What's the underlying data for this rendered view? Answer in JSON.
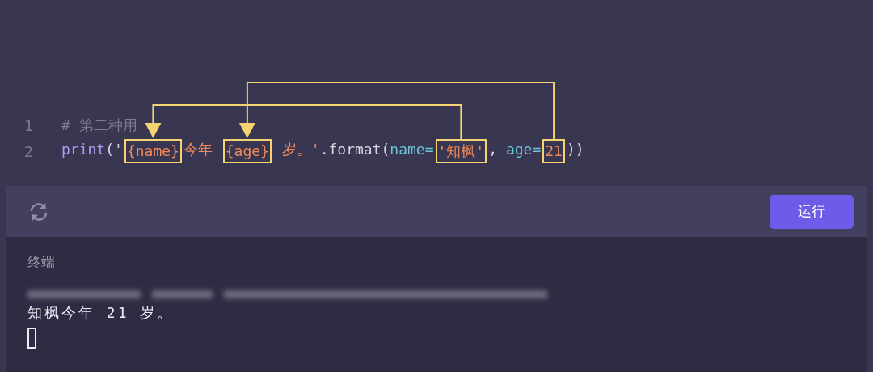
{
  "editor": {
    "lines": [
      {
        "number": "1",
        "tokens": [
          {
            "text": "# 第二种用",
            "kind": "comment",
            "boxed": false
          }
        ]
      },
      {
        "number": "2",
        "tokens": [
          {
            "text": "print",
            "kind": "function",
            "boxed": false
          },
          {
            "text": "('",
            "kind": "punct",
            "boxed": false
          },
          {
            "text": "{name}",
            "kind": "string",
            "boxed": true
          },
          {
            "text": "今年 ",
            "kind": "string",
            "boxed": false
          },
          {
            "text": "{age}",
            "kind": "string",
            "boxed": true
          },
          {
            "text": " 岁。'",
            "kind": "string",
            "boxed": false
          },
          {
            "text": ".format(",
            "kind": "punct",
            "boxed": false
          },
          {
            "text": "name=",
            "kind": "param",
            "boxed": false
          },
          {
            "text": "'知枫'",
            "kind": "string",
            "boxed": true
          },
          {
            "text": ", ",
            "kind": "punct",
            "boxed": false
          },
          {
            "text": "age=",
            "kind": "param",
            "boxed": false
          },
          {
            "text": "21",
            "kind": "string",
            "boxed": true
          },
          {
            "text": "))",
            "kind": "punct",
            "boxed": false
          }
        ]
      }
    ]
  },
  "toolbar": {
    "run_button": "运行"
  },
  "terminal": {
    "title": "终端",
    "output": [
      "知枫今年 21 岁。"
    ],
    "cursor": true
  }
}
